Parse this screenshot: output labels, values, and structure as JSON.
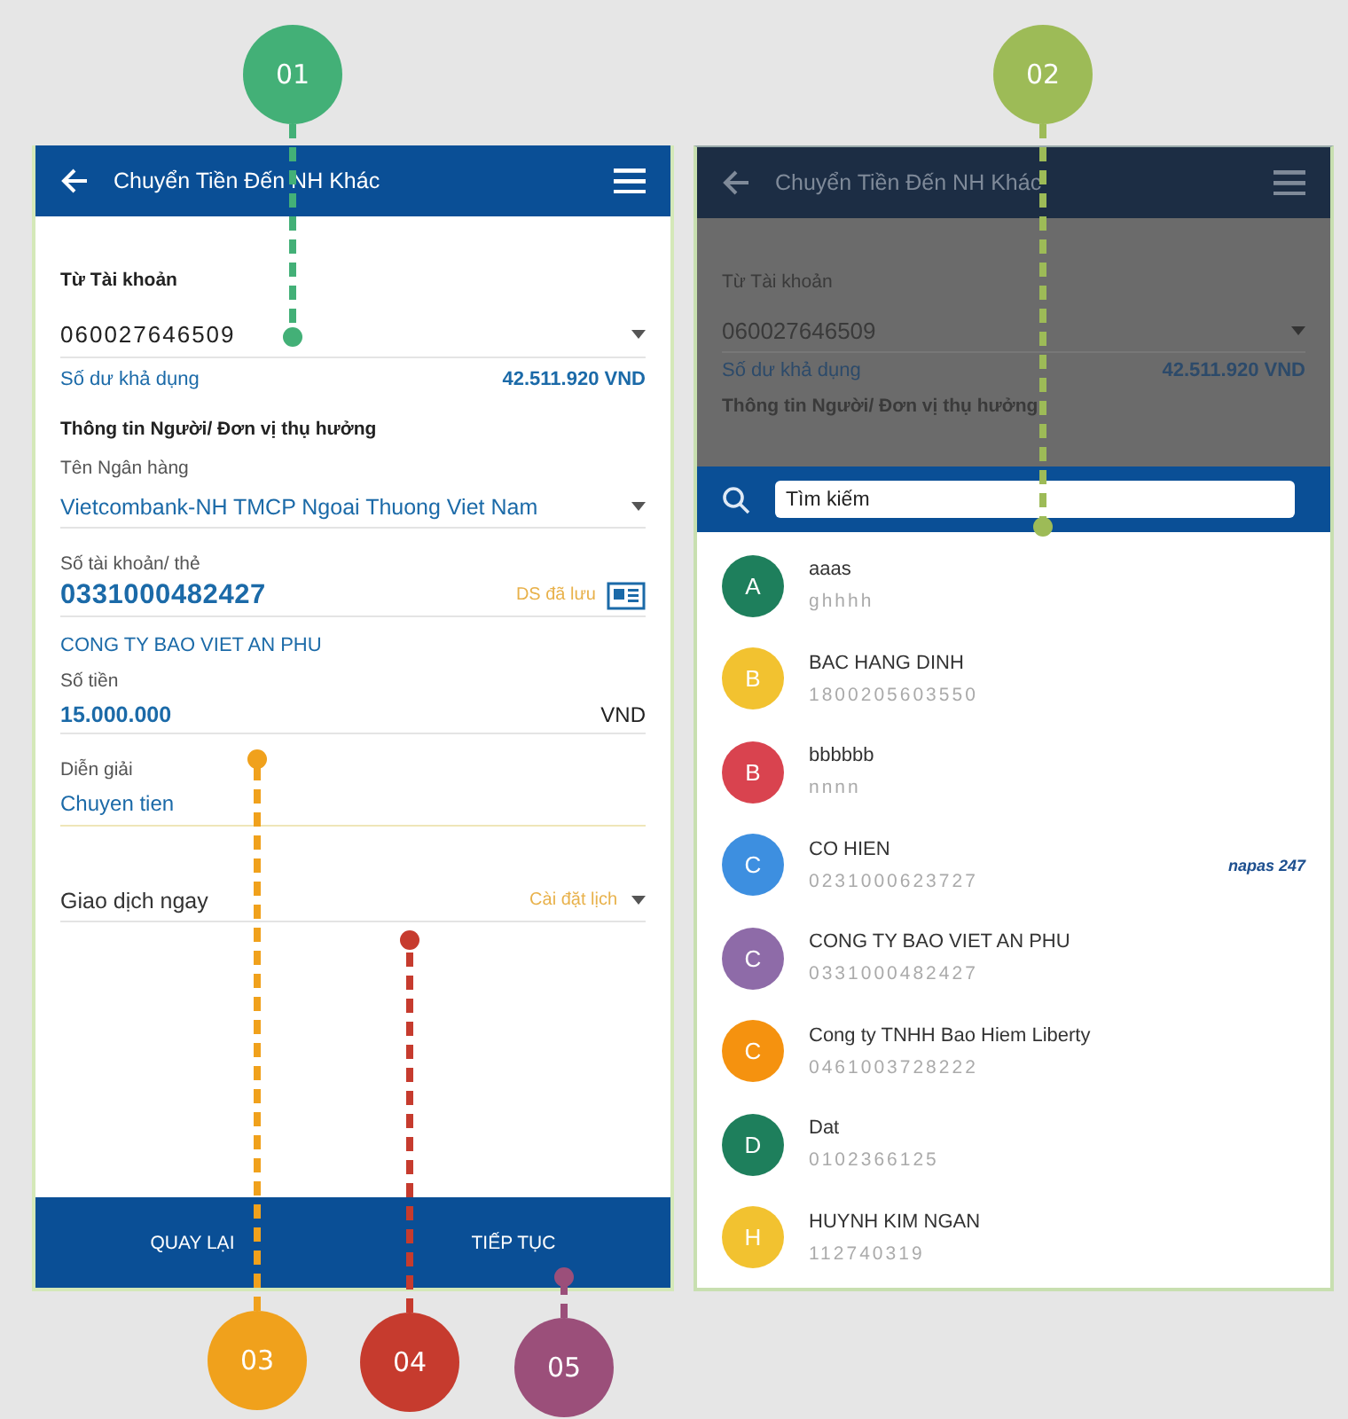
{
  "callouts": [
    {
      "label": "01",
      "color": "#43b077"
    },
    {
      "label": "02",
      "color": "#9dbb57"
    },
    {
      "label": "03",
      "color": "#f0a11c"
    },
    {
      "label": "04",
      "color": "#c63b2e"
    },
    {
      "label": "05",
      "color": "#9b4f7a"
    }
  ],
  "transfer_screen": {
    "title": "Chuyển Tiền Đến NH Khác",
    "from_account": {
      "label": "Từ Tài khoản",
      "value": "060027646509"
    },
    "balance": {
      "label": "Số dư khả dụng",
      "value": "42.511.920 VND"
    },
    "beneficiary_heading": "Thông tin Người/ Đơn vị thụ hưởng",
    "bank": {
      "label": "Tên Ngân hàng",
      "value": "Vietcombank-NH TMCP Ngoai Thuong Viet Nam"
    },
    "account_number": {
      "label": "Số tài khoản/ thẻ",
      "value": "0331000482427",
      "saved_link": "DS đã lưu"
    },
    "account_name": "CONG TY BAO VIET AN PHU",
    "amount": {
      "label": "Số tiền",
      "value": "15.000.000",
      "currency": "VND"
    },
    "description": {
      "label": "Diễn giải",
      "value": "Chuyen tien"
    },
    "schedule": {
      "value": "Giao dịch ngay",
      "link": "Cài đặt lịch"
    },
    "buttons": [
      "QUAY LẠI",
      "TIẾP TỤC"
    ]
  },
  "beneficiary_picker": {
    "title": "Chuyển Tiền Đến NH Khác",
    "from_account": {
      "label": "Từ Tài khoản",
      "value": "060027646509"
    },
    "balance": {
      "label": "Số dư khả dụng",
      "value": "42.511.920 VND"
    },
    "beneficiary_heading": "Thông tin Người/ Đơn vị thụ hưởng",
    "search": {
      "placeholder": "Tìm kiếm"
    },
    "contacts": [
      {
        "initial": "A",
        "name": "aaas",
        "account": "ghhhh",
        "color": "#1e7f5c"
      },
      {
        "initial": "B",
        "name": "BAC HANG DINH",
        "account": "1800205603550",
        "color": "#f2c230"
      },
      {
        "initial": "B",
        "name": "bbbbbb",
        "account": "nnnn",
        "color": "#d9434f"
      },
      {
        "initial": "C",
        "name": "CO HIEN",
        "account": "0231000623727",
        "color": "#3d8fe0",
        "badge": "napas 247"
      },
      {
        "initial": "C",
        "name": "CONG TY BAO VIET AN PHU",
        "account": "0331000482427",
        "color": "#8e6ba8"
      },
      {
        "initial": "C",
        "name": "Cong ty TNHH Bao Hiem Liberty",
        "account": "0461003728222",
        "color": "#f5920f"
      },
      {
        "initial": "D",
        "name": "Dat",
        "account": "0102366125",
        "color": "#1e7f5c"
      },
      {
        "initial": "H",
        "name": "HUYNH KIM NGAN",
        "account": "112740319",
        "color": "#f2c230"
      }
    ]
  }
}
